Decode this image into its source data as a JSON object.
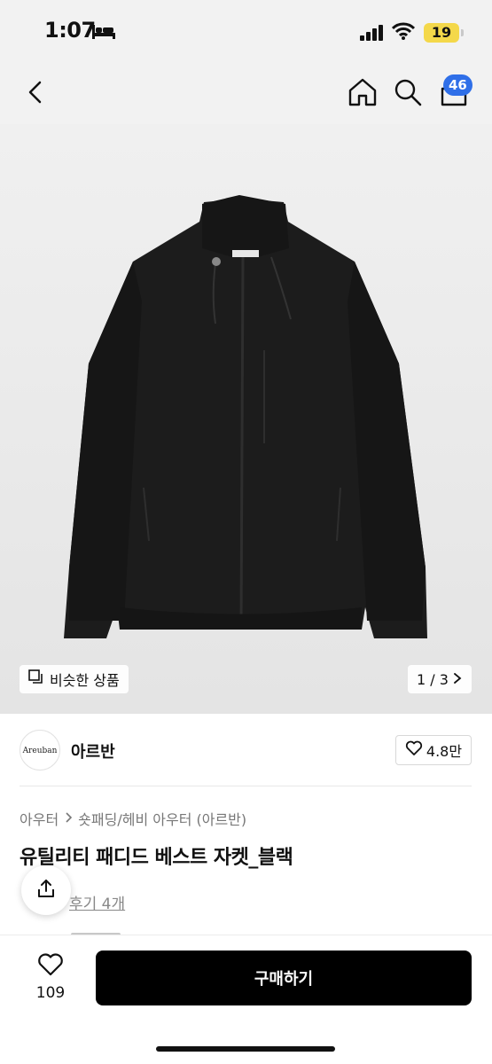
{
  "status_bar": {
    "time": "1:07",
    "battery": "19",
    "icons": [
      "bed-icon",
      "signal-icon",
      "wifi-icon",
      "battery-icon"
    ],
    "battery_color": "#f4d84a"
  },
  "nav": {
    "icons": [
      "back-icon",
      "home-icon",
      "search-icon",
      "cart-icon"
    ],
    "cart_badge": "46",
    "badge_color": "#2f6fe8"
  },
  "product_image": {
    "icons": [
      "jacket-image"
    ],
    "similar_label": "비슷한 상품",
    "page_indicator": "1 / 3"
  },
  "brand": {
    "logo_text": "Areuban",
    "name": "아르반",
    "likes": "4.8만"
  },
  "product": {
    "breadcrumb": [
      "아우터",
      "숏패딩/헤비 아우터 (아르반)"
    ],
    "title": "유틸리티 패디드 베스트 자켓_블랙",
    "review_link": "후기 4개"
  },
  "bottom": {
    "wish_count": "109",
    "buy_label": "구매하기",
    "buy_color": "#000000"
  }
}
